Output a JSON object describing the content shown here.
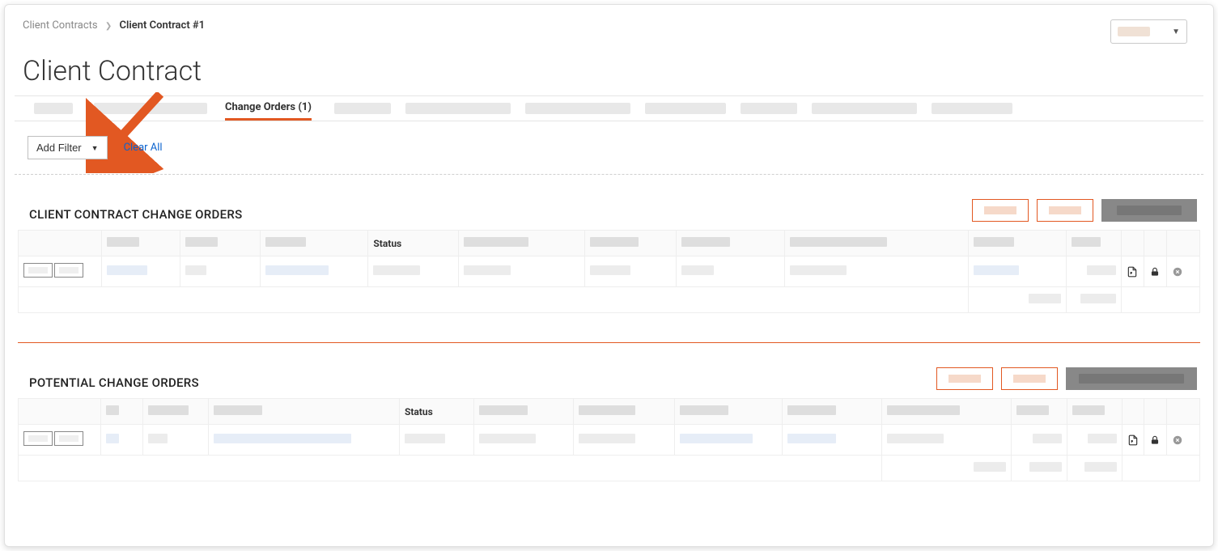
{
  "breadcrumb": {
    "root": "Client Contracts",
    "current": "Client Contract #1"
  },
  "page_title": "Client Contract",
  "tabs": {
    "active_label": "Change Orders (1)"
  },
  "filters": {
    "add_filter_label": "Add Filter",
    "clear_all_label": "Clear All"
  },
  "sections": {
    "client_change_orders": {
      "title": "CLIENT CONTRACT CHANGE ORDERS",
      "columns": {
        "status_label": "Status"
      }
    },
    "potential_change_orders": {
      "title": "POTENTIAL CHANGE ORDERS",
      "columns": {
        "status_label": "Status"
      }
    }
  },
  "icons": {
    "pdf": "pdf-file-icon",
    "lock": "lock-icon",
    "cancel": "cancel-circle-icon"
  }
}
